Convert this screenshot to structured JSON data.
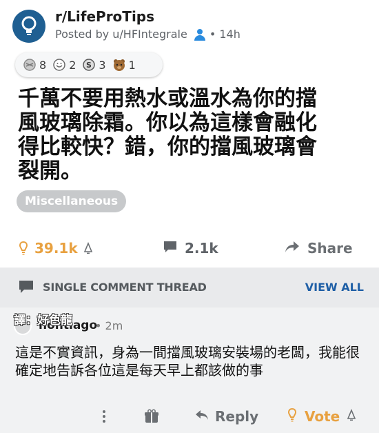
{
  "post": {
    "subreddit": "r/LifeProTips",
    "posted_by": "Posted by u/HFIntegrale",
    "age": "• 14h",
    "awards": [
      {
        "icon": "silver-award-icon",
        "count": "8"
      },
      {
        "icon": "helpful-award-icon",
        "count": "2"
      },
      {
        "icon": "coin-award-icon",
        "count": "3"
      },
      {
        "icon": "bear-award-icon",
        "count": "1"
      }
    ],
    "title": "千萬不要用熱水或溫水為你的擋風玻璃除霜。你以為這樣會融化得比較快？錯，你的擋風玻璃會裂開。",
    "flair": "Miscellaneous",
    "upvotes": "39.1k",
    "comments": "2.1k",
    "share_label": "Share"
  },
  "thread_bar": {
    "label": "SINGLE COMMENT THREAD",
    "view_all": "VIEW ALL"
  },
  "comment": {
    "translator": "譯：好色龍",
    "author": "nontiago",
    "time": "• 2m",
    "body": "這是不實資訊，身為一間擋風玻璃安裝場的老闆，我能很確定地告訴各位這是每天早上都該做的事",
    "reply_label": "Reply",
    "vote_label": "Vote"
  },
  "colors": {
    "accent_orange": "#e8a140",
    "link_blue": "#1f5fa6",
    "sub_icon_blue": "#1f5f92",
    "user_icon_blue": "#2a8bde"
  }
}
